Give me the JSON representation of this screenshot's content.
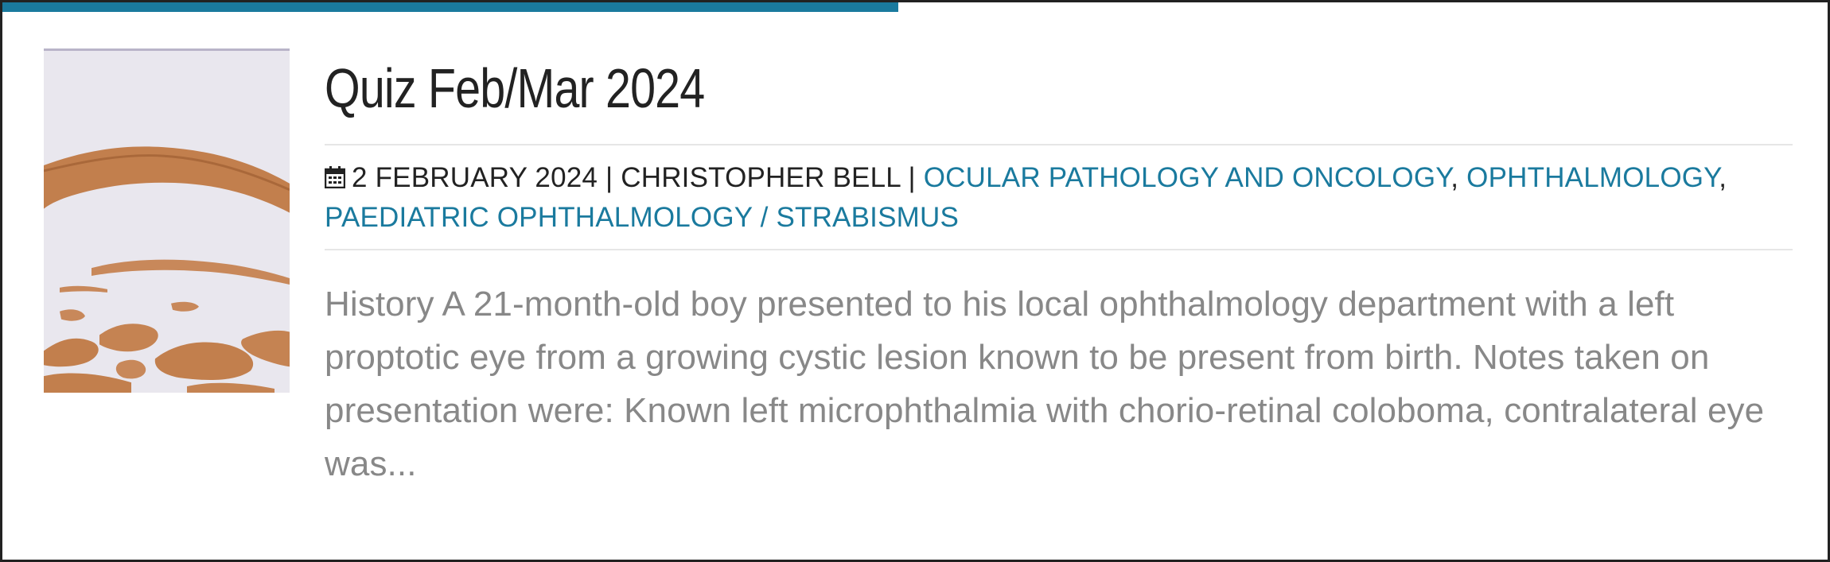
{
  "post": {
    "title": "Quiz Feb/Mar 2024",
    "date": "2 FEBRUARY 2024",
    "separator": " | ",
    "author": "CHRISTOPHER BELL",
    "categories": [
      "OCULAR PATHOLOGY AND ONCOLOGY",
      "OPHTHALMOLOGY",
      "PAEDIATRIC OPHTHALMOLOGY / STRABISMUS"
    ],
    "category_separator": ",",
    "excerpt": "History A 21-month-old boy presented to his local ophthalmology department with a left proptotic eye from a growing cystic lesion known to be present from birth. Notes taken on presentation were: Known left microphthalmia with chorio-retinal coloboma, contralateral eye was...",
    "icon": "calendar-icon"
  },
  "colors": {
    "accent": "#1a7a9e",
    "title_text": "#222222",
    "meta_text": "#222222",
    "excerpt_text": "#888888",
    "tissue": "#c07d4a"
  }
}
